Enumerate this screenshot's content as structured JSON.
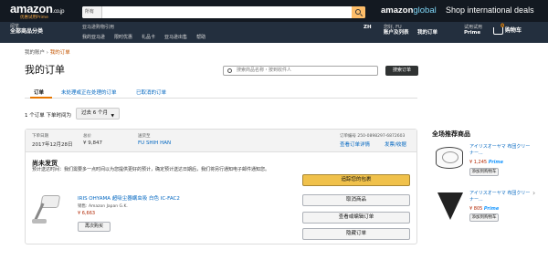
{
  "header": {
    "logo": "amazon",
    "logo_suffix": ".co.jp",
    "logo_tagline": "优惠试用Prime",
    "search_category": "所有",
    "promo_logo": "amazon",
    "promo_logo_suffix": "global",
    "promo_text": "Shop international deals",
    "deliver_line1": "阅览",
    "deliver_line2": "全部商品分类",
    "nav_small": "亚马逊购物引用",
    "nav_links": [
      "我的亚马逊",
      "限时优惠",
      "礼品卡",
      "亚马逊出售",
      "帮助"
    ],
    "lang": "ZH",
    "hello_line1": "您好, FU",
    "hello_line2": "账户及列表",
    "orders_line1": "我的订单",
    "prime_line1": "试用试用",
    "prime_line2": "Prime",
    "cart_count": "0",
    "cart_label": "购物车"
  },
  "breadcrumb": {
    "root": "我的账户",
    "sep": "›",
    "current": "我的订单"
  },
  "page_title": "我的订单",
  "order_search": {
    "placeholder": "搜索商品名称・按到收件人",
    "button": "搜索订单"
  },
  "tabs": [
    "订单",
    "未处理或正在处理的订单",
    "已取消的订单"
  ],
  "filter": {
    "count_text": "1 个订单 下单时间为",
    "period": "过去 6 个月"
  },
  "order": {
    "date_label": "下单日期",
    "date": "2017年12月28日",
    "total_label": "总价",
    "total": "¥ 9,847",
    "ship_to_label": "送货至",
    "ship_to": "FU SHIH HAN",
    "number_label": "订单编号 250-0898297-6872603",
    "details_link": "查看订单详情",
    "invoice_link": "发票/收据",
    "status": "尚未发货",
    "note": "预计送达时间：我们需要多一点时间以为您提供更好的预计，确定预计送达日期后，我们将另行通知电子邮件通知您。",
    "product_title": "IRIS OHYAMA 超吸尘器螨虫吸 白色 IC-FAC2",
    "seller": "销售: Amazon Japan G.K.",
    "price": "¥ 6,663",
    "rebuy": "再次购买",
    "actions": [
      "追踪您的包裹",
      "取消商品",
      "查看或编辑订单",
      "隐藏订单"
    ]
  },
  "recommend": {
    "title": "全场推荐商品",
    "items": [
      {
        "name": "アイリスオーヤマ 布団クリーナー...",
        "price": "¥ 1,245",
        "prime": "Prime",
        "button": "添加到购物车"
      },
      {
        "name": "アイリスオーヤマ 布団クリーナー...",
        "price": "¥ 805",
        "prime": "Prime",
        "button": "添加到购物车"
      }
    ],
    "next": "›"
  }
}
